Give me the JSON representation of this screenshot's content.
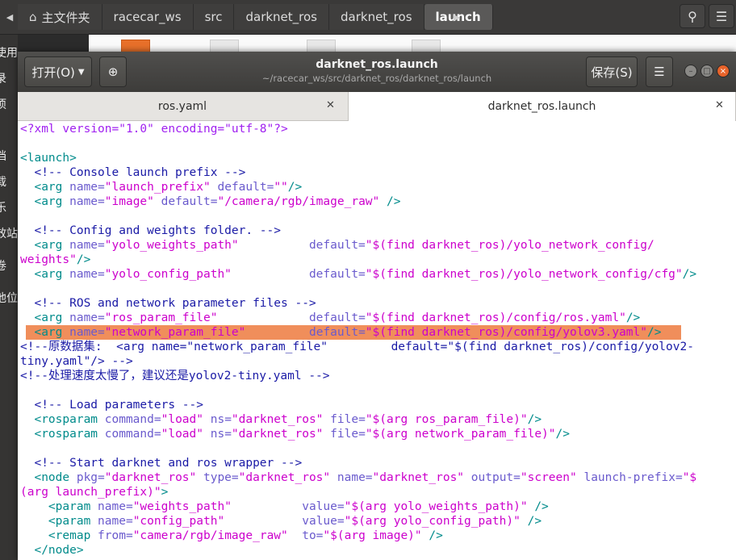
{
  "nautilus": {
    "home_label": "主文件夹",
    "crumbs": [
      "racecar_ws",
      "src",
      "darknet_ros",
      "darknet_ros",
      "launch"
    ],
    "sidebar_fragments": [
      "使用",
      "录",
      "项",
      "",
      "档",
      "载",
      "乐",
      "效站",
      "卷",
      "他位置"
    ]
  },
  "gedit": {
    "open_label": "打开(O)",
    "save_label": "保存(S)",
    "title": "darknet_ros.launch",
    "subtitle": "~/racecar_ws/src/darknet_ros/darknet_ros/launch",
    "tabs": [
      {
        "label": "ros.yaml",
        "active": false
      },
      {
        "label": "darknet_ros.launch",
        "active": true
      }
    ],
    "highlight_line": 14,
    "lines": [
      [
        [
          "pi",
          "<?xml version=\"1.0\" encoding=\"utf-8\"?>"
        ]
      ],
      [],
      [
        [
          "tag",
          "<launch>"
        ]
      ],
      [
        [
          "com",
          "  <!-- Console launch prefix -->"
        ]
      ],
      [
        [
          "tag",
          "  <arg"
        ],
        [
          "att",
          " name="
        ],
        [
          "str",
          "\"launch_prefix\""
        ],
        [
          "att",
          " default="
        ],
        [
          "str",
          "\"\""
        ],
        [
          "tag",
          "/>"
        ]
      ],
      [
        [
          "tag",
          "  <arg"
        ],
        [
          "att",
          " name="
        ],
        [
          "str",
          "\"image\""
        ],
        [
          "att",
          " default="
        ],
        [
          "str",
          "\"/camera/rgb/image_raw\""
        ],
        [
          "tag",
          " />"
        ]
      ],
      [],
      [
        [
          "com",
          "  <!-- Config and weights folder. -->"
        ]
      ],
      [
        [
          "tag",
          "  <arg"
        ],
        [
          "att",
          " name="
        ],
        [
          "str",
          "\"yolo_weights_path\""
        ],
        [
          "att",
          "          default="
        ],
        [
          "str",
          "\"$(find darknet_ros)/yolo_network_config/"
        ]
      ],
      [
        [
          "str",
          "weights\""
        ],
        [
          "tag",
          "/>"
        ]
      ],
      [
        [
          "tag",
          "  <arg"
        ],
        [
          "att",
          " name="
        ],
        [
          "str",
          "\"yolo_config_path\""
        ],
        [
          "att",
          "           default="
        ],
        [
          "str",
          "\"$(find darknet_ros)/yolo_network_config/cfg\""
        ],
        [
          "tag",
          "/>"
        ]
      ],
      [],
      [
        [
          "com",
          "  <!-- ROS and network parameter files -->"
        ]
      ],
      [
        [
          "tag",
          "  <arg"
        ],
        [
          "att",
          " name="
        ],
        [
          "str",
          "\"ros_param_file\""
        ],
        [
          "att",
          "             default="
        ],
        [
          "str",
          "\"$(find darknet_ros)/config/ros.yaml\""
        ],
        [
          "tag",
          "/>"
        ]
      ],
      [
        [
          "tag",
          "  <arg"
        ],
        [
          "att",
          " name="
        ],
        [
          "str",
          "\"network_param_file\""
        ],
        [
          "att",
          "         default="
        ],
        [
          "str",
          "\"$(find darknet_ros)/config/yolov3.yaml\""
        ],
        [
          "tag",
          "/>"
        ]
      ],
      [
        [
          "com",
          "<!--原数据集:  <arg name=\"network_param_file\"         default=\"$(find darknet_ros)/config/yolov2-"
        ]
      ],
      [
        [
          "com",
          "tiny.yaml\"/> -->"
        ]
      ],
      [
        [
          "com",
          "<!--处理速度太慢了，建议还是yolov2-tiny.yaml -->"
        ]
      ],
      [],
      [
        [
          "com",
          "  <!-- Load parameters -->"
        ]
      ],
      [
        [
          "tag",
          "  <rosparam"
        ],
        [
          "att",
          " command="
        ],
        [
          "str",
          "\"load\""
        ],
        [
          "att",
          " ns="
        ],
        [
          "str",
          "\"darknet_ros\""
        ],
        [
          "att",
          " file="
        ],
        [
          "str",
          "\"$(arg ros_param_file)\""
        ],
        [
          "tag",
          "/>"
        ]
      ],
      [
        [
          "tag",
          "  <rosparam"
        ],
        [
          "att",
          " command="
        ],
        [
          "str",
          "\"load\""
        ],
        [
          "att",
          " ns="
        ],
        [
          "str",
          "\"darknet_ros\""
        ],
        [
          "att",
          " file="
        ],
        [
          "str",
          "\"$(arg network_param_file)\""
        ],
        [
          "tag",
          "/>"
        ]
      ],
      [],
      [
        [
          "com",
          "  <!-- Start darknet and ros wrapper -->"
        ]
      ],
      [
        [
          "tag",
          "  <node"
        ],
        [
          "att",
          " pkg="
        ],
        [
          "str",
          "\"darknet_ros\""
        ],
        [
          "att",
          " type="
        ],
        [
          "str",
          "\"darknet_ros\""
        ],
        [
          "att",
          " name="
        ],
        [
          "str",
          "\"darknet_ros\""
        ],
        [
          "att",
          " output="
        ],
        [
          "str",
          "\"screen\""
        ],
        [
          "att",
          " launch-prefix="
        ],
        [
          "str",
          "\"$"
        ]
      ],
      [
        [
          "str",
          "(arg launch_prefix)\""
        ],
        [
          "tag",
          ">"
        ]
      ],
      [
        [
          "tag",
          "    <param"
        ],
        [
          "att",
          " name="
        ],
        [
          "str",
          "\"weights_path\""
        ],
        [
          "att",
          "          value="
        ],
        [
          "str",
          "\"$(arg yolo_weights_path)\""
        ],
        [
          "tag",
          " />"
        ]
      ],
      [
        [
          "tag",
          "    <param"
        ],
        [
          "att",
          " name="
        ],
        [
          "str",
          "\"config_path\""
        ],
        [
          "att",
          "           value="
        ],
        [
          "str",
          "\"$(arg yolo_config_path)\""
        ],
        [
          "tag",
          " />"
        ]
      ],
      [
        [
          "tag",
          "    <remap"
        ],
        [
          "att",
          " from="
        ],
        [
          "str",
          "\"camera/rgb/image_raw\""
        ],
        [
          "att",
          "  to="
        ],
        [
          "str",
          "\"$(arg image)\""
        ],
        [
          "tag",
          " />"
        ]
      ],
      [
        [
          "tag",
          "  </node>"
        ]
      ]
    ]
  },
  "colors": {
    "tag": "#008b8b",
    "attribute": "#6a5acd",
    "string": "#cc00cc",
    "comment": "#1a1aa6",
    "highlight": "#f08e5b"
  }
}
